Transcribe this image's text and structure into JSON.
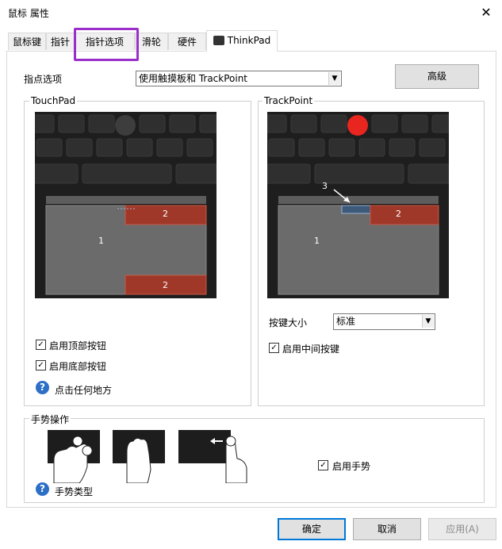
{
  "window": {
    "title": "鼠标 属性",
    "close_glyph": "✕"
  },
  "tabs": [
    {
      "label": "鼠标键"
    },
    {
      "label": "指针"
    },
    {
      "label": "指针选项"
    },
    {
      "label": "滑轮"
    },
    {
      "label": "硬件"
    },
    {
      "label": "ThinkPad"
    }
  ],
  "pointing": {
    "label": "指点选项",
    "selected": "使用触摸板和 TrackPoint",
    "advanced_label": "高级"
  },
  "touchpad": {
    "legend": "TouchPad",
    "zone_labels": [
      "1",
      "2",
      "2"
    ],
    "enable_top_buttons": {
      "label": "启用顶部按钮",
      "checked": true
    },
    "enable_bottom_buttons": {
      "label": "启用底部按钮",
      "checked": true
    },
    "click_anywhere_label": "点击任何地方"
  },
  "trackpoint": {
    "legend": "TrackPoint",
    "zone_labels": [
      "1",
      "2",
      "3"
    ],
    "button_size_label": "按键大小",
    "button_size_value": "标准",
    "enable_middle_button": {
      "label": "启用中间按键",
      "checked": true
    },
    "dot_color": "#e8261f"
  },
  "gestures": {
    "legend": "手势操作",
    "enable_gestures": {
      "label": "启用手势",
      "checked": true
    },
    "gesture_types_label": "手势类型"
  },
  "footer": {
    "ok_label": "确定",
    "cancel_label": "取消",
    "apply_label": "应用(A)"
  },
  "colors": {
    "tab_highlight": "#9b2fc9",
    "zone_red": "#a0382a",
    "primary_border": "#0078d7"
  }
}
